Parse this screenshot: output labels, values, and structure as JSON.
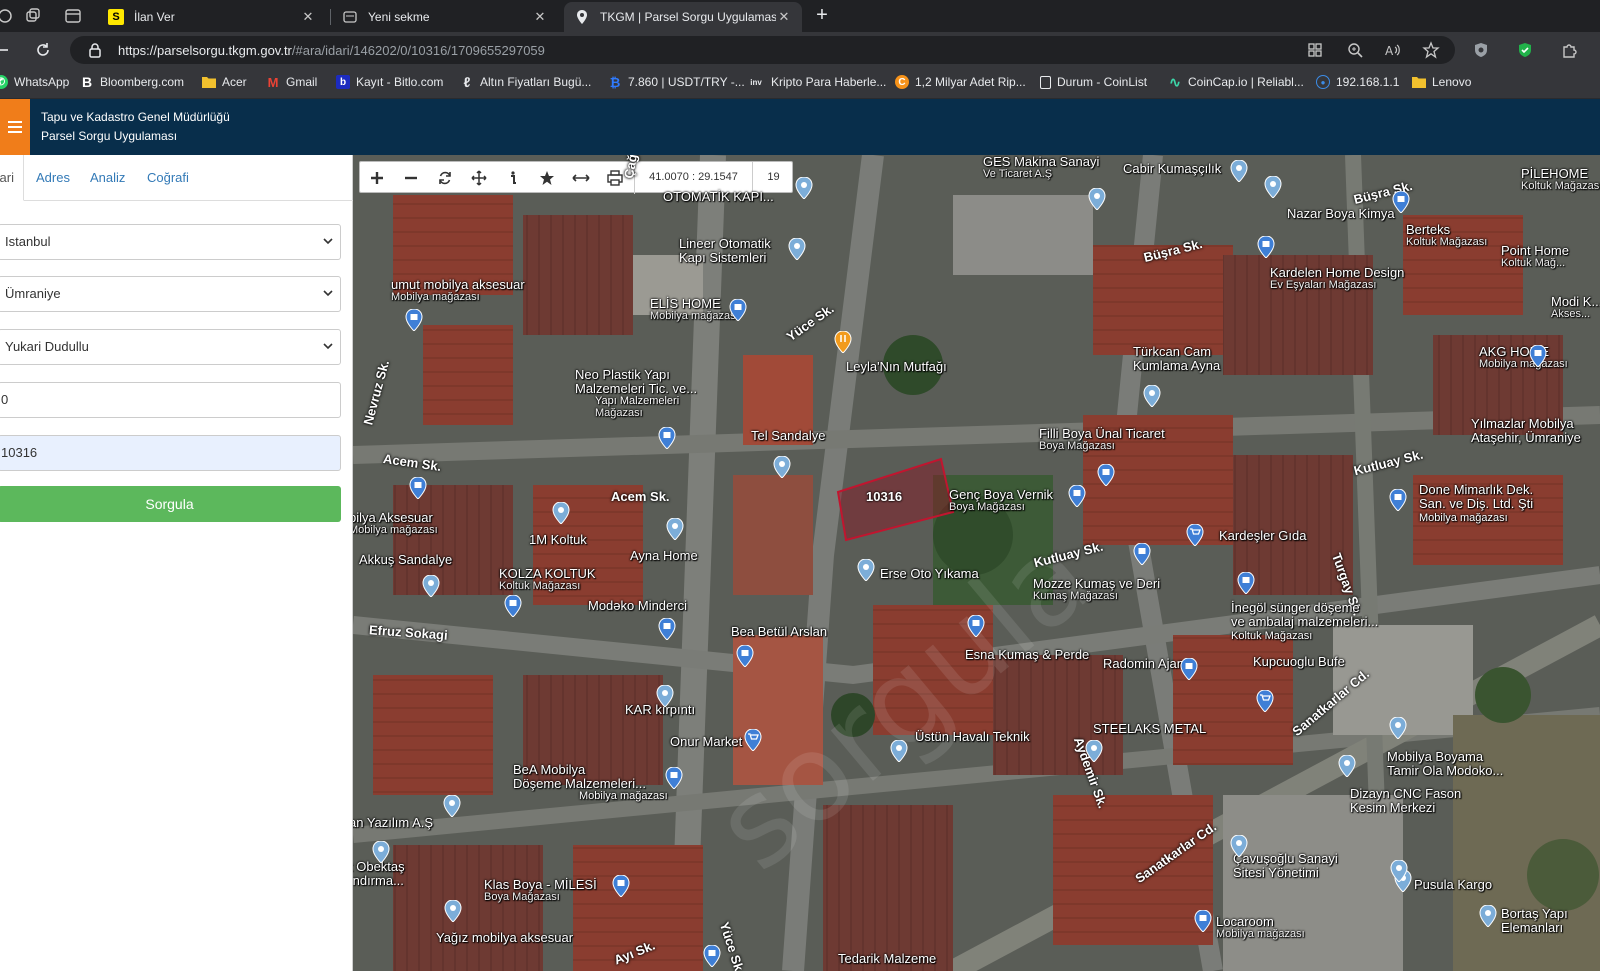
{
  "browser": {
    "tabs": [
      {
        "title": "İlan Ver",
        "close": "✕",
        "active": false
      },
      {
        "title": "Yeni sekme",
        "close": "✕",
        "active": false
      },
      {
        "title": "TKGM | Parsel Sorgu Uygulaması",
        "close": "✕",
        "active": true
      }
    ],
    "new_tab": "+",
    "url_host": "https://parselsorgu.tkgm.gov.tr",
    "url_path": "/#ara/idari/146202/0/10316/1709655297059",
    "bookmarks": [
      {
        "label": "WhatsApp",
        "icon": "W",
        "color": "#25d366"
      },
      {
        "label": "Bloomberg.com",
        "icon": "B",
        "color": "#000000"
      },
      {
        "label": "Acer",
        "icon": "folder",
        "color": "#f2c12e"
      },
      {
        "label": "Gmail",
        "icon": "M",
        "color": "#ea4335"
      },
      {
        "label": "Kayıt - Bitlo.com",
        "icon": "b",
        "color": "#1c2bbf"
      },
      {
        "label": "Altın Fiyatları Bugü...",
        "icon": "ℓ",
        "color": "#e8eaed"
      },
      {
        "label": "7.860 | USDT/TRY -...",
        "icon": "₿",
        "color": "#2f7bff"
      },
      {
        "label": "Kripto Para Haberle...",
        "icon": "inv",
        "color": "#444444"
      },
      {
        "label": "1,2 Milyar Adet Rip...",
        "icon": "C",
        "color": "#f7931a"
      },
      {
        "label": "Durum - CoinList",
        "icon": "□",
        "color": "#202124"
      },
      {
        "label": "CoinCap.io | Reliabl...",
        "icon": "∿",
        "color": "#3dd6a9"
      },
      {
        "label": "192.168.1.1",
        "icon": "◎",
        "color": "#3c8ce7"
      },
      {
        "label": "Lenovo",
        "icon": "folder",
        "color": "#f2c12e"
      }
    ]
  },
  "header": {
    "org": "Tapu ve Kadastro Genel Müdürlüğü",
    "app": "Parsel Sorgu Uygulaması"
  },
  "panel": {
    "tabs": [
      "İdari",
      "Adres",
      "Analiz",
      "Coğrafi"
    ],
    "province": "Istanbul",
    "district": "Ümraniye",
    "neighborhood": "Yukari Dudullu",
    "block": "0",
    "parcel": "10316",
    "submit": "Sorgula"
  },
  "map": {
    "coords": "41.0070 : 29.1547",
    "zoom": "19",
    "parcel_label": "10316",
    "streets": [
      "Çağlar Sk.",
      "Yüce Sk.",
      "Nevruz Sk.",
      "Acem Sk.",
      "Acem Sk.",
      "Efruz Sokagi",
      "Kutluay Sk.",
      "Kutluay Sk.",
      "Büşra Sk.",
      "Büşra Sk.",
      "Turgay Sk.",
      "Aydemir Sk.",
      "Sanatkarlar Cd.",
      "Sanatkarlar Cd.",
      "Yüce Sk.",
      "Ayı Sk."
    ],
    "places": [
      {
        "name": "GES Makina Sanayi",
        "sub": "Ve Ticaret A.Ş"
      },
      {
        "name": "Cabir Kumaşçılık",
        "sub": ""
      },
      {
        "name": "OTOMATİK KAPI...",
        "sub": ""
      },
      {
        "name": "Lineer Otomatik",
        "sub": "Kapı Sistemleri"
      },
      {
        "name": "umut mobilya aksesuar",
        "sub": "Mobilya mağazası"
      },
      {
        "name": "ELİS HOME",
        "sub": "Mobilya mağazası"
      },
      {
        "name": "Leyla'Nın Mutfağı",
        "sub": ""
      },
      {
        "name": "Neo Plastik Yapı",
        "sub": "Malzemeleri Tic. ve..."
      },
      {
        "name": "Yapı Malzemeleri",
        "sub": "Mağazası"
      },
      {
        "name": "Tel Sandalye",
        "sub": ""
      },
      {
        "name": "Nazar Boya Kimya",
        "sub": ""
      },
      {
        "name": "Kardelen Home Design",
        "sub": "Ev Eşyaları Mağazası"
      },
      {
        "name": "Berteks",
        "sub": "Koltuk Mağazası"
      },
      {
        "name": "Point Home",
        "sub": "Koltuk Mağ..."
      },
      {
        "name": "PİLEHOME",
        "sub": "Koltuk Mağazası"
      },
      {
        "name": "Modi K...",
        "sub": "Akses..."
      },
      {
        "name": "AKG HOME",
        "sub": "Mobilya mağazası"
      },
      {
        "name": "Türkcan Cam",
        "sub": "Kumlama Ayna"
      },
      {
        "name": "Filli Boya Ünal Ticaret",
        "sub": "Boya Mağazası"
      },
      {
        "name": "Genç Boya Vernik",
        "sub": "Boya Mağazası"
      },
      {
        "name": "Yılmazlar Mobilya",
        "sub": "Ataşehir, Ümraniye"
      },
      {
        "name": "Done Mimarlık Dek.",
        "sub": "San. ve Diş. Ltd. Şti"
      },
      {
        "name": "Mobilya mağazası",
        "sub": ""
      },
      {
        "name": "Kardeşler Gıda",
        "sub": ""
      },
      {
        "name": "Erse Oto Yıkama",
        "sub": ""
      },
      {
        "name": "Mozze Kumaş ve Deri",
        "sub": "Kumaş Mağazası"
      },
      {
        "name": "İnegöl sünger döşeme",
        "sub": "ve ambalaj malzemeleri..."
      },
      {
        "name": "Koltuk Mağazası",
        "sub": ""
      },
      {
        "name": "Akkuş Sandalye",
        "sub": ""
      },
      {
        "name": "bilya Aksesuar",
        "sub": "Mobilya mağazası"
      },
      {
        "name": "1M Koltuk",
        "sub": ""
      },
      {
        "name": "Ayna Home",
        "sub": ""
      },
      {
        "name": "KOLZA KOLTUK",
        "sub": "Koltuk Mağazası"
      },
      {
        "name": "Modəko Minderci",
        "sub": ""
      },
      {
        "name": "Bea Betül Arslan",
        "sub": ""
      },
      {
        "name": "Esna Kumaş & Perde",
        "sub": ""
      },
      {
        "name": "Radomin Ajans",
        "sub": ""
      },
      {
        "name": "Kupcuoglu Bufe",
        "sub": ""
      },
      {
        "name": "KAR kırpıntı",
        "sub": ""
      },
      {
        "name": "Onur Market",
        "sub": ""
      },
      {
        "name": "Üstün Havalı Teknik",
        "sub": ""
      },
      {
        "name": "STEELAKS METAL",
        "sub": ""
      },
      {
        "name": "Mobilya Boyama",
        "sub": "Tamir Ola Modoko..."
      },
      {
        "name": "Dizayn CNC Fason",
        "sub": "Kesim Merkezi"
      },
      {
        "name": "BeA Mobilya",
        "sub": "Döşeme Malzemeleri..."
      },
      {
        "name": "Mobilya mağazası",
        "sub": ""
      },
      {
        "name": "an Yazılım A.Ş",
        "sub": ""
      },
      {
        "name": "Çavuşoğlu Sanayi",
        "sub": "Sitesi Yönetimi"
      },
      {
        "name": "Pusula Kargo",
        "sub": ""
      },
      {
        "name": "t Obektaş",
        "sub": "ındırma..."
      },
      {
        "name": "Klas Boya - MİLESİ",
        "sub": "Boya Mağazası"
      },
      {
        "name": "Locaroom",
        "sub": "Mobilya mağazası"
      },
      {
        "name": "Bortaş Yapı",
        "sub": "Elemanları"
      },
      {
        "name": "Yağız mobilya aksesuar",
        "sub": ""
      },
      {
        "name": "Tedarik Malzeme",
        "sub": ""
      }
    ]
  }
}
